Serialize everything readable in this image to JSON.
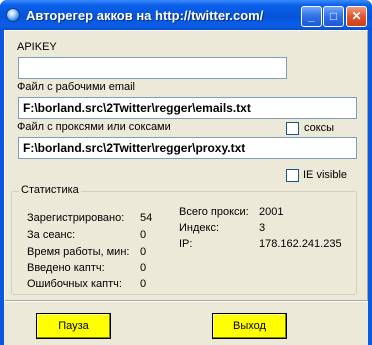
{
  "window": {
    "title": "Авторегер акков на http://twitter.com/",
    "minimize_glyph": "_",
    "maximize_glyph": "□",
    "close_glyph": "✕"
  },
  "form": {
    "apikey_label": "APIKEY",
    "apikey_value": "",
    "email_file_label": "Файл с рабочими email",
    "email_file_value": "F:\\borland.src\\2Twitter\\regger\\emails.txt",
    "proxy_file_label": "Файл с проксями или соксами",
    "proxy_file_value": "F:\\borland.src\\2Twitter\\regger\\proxy.txt",
    "socks_label": "соксы",
    "socks_checked": false,
    "ie_visible_label": "IE visible",
    "ie_visible_checked": false
  },
  "stats": {
    "title": "Статистика",
    "left": [
      {
        "label": "Зарегистрировано:",
        "value": "54"
      },
      {
        "label": "За сеанс:",
        "value": "0"
      },
      {
        "label": "Время работы, мин:",
        "value": "0"
      },
      {
        "label": "Введено каптч:",
        "value": "0"
      },
      {
        "label": "Ошибочных каптч:",
        "value": "0"
      }
    ],
    "right": [
      {
        "label": "Всего прокси:",
        "value": "2001"
      },
      {
        "label": "Индекс:",
        "value": "3"
      },
      {
        "label": "IP:",
        "value": "178.162.241.235"
      }
    ]
  },
  "buttons": {
    "pause_label": "Пауза",
    "exit_label": "Выход"
  },
  "colors": {
    "titlebar": "#0a5fe8",
    "button_bg": "#ffff00",
    "client_bg": "#ece9d8"
  }
}
